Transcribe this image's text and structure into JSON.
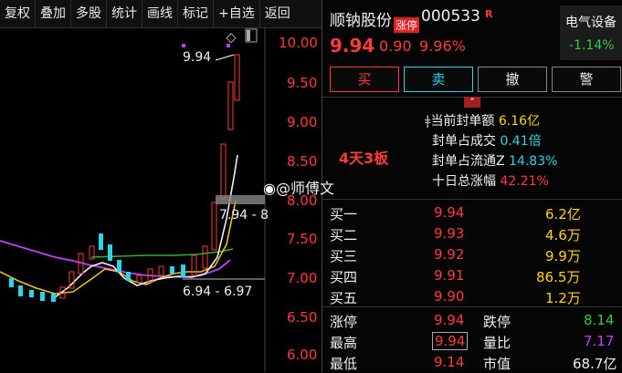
{
  "toolbar": [
    "复权",
    "叠加",
    "多股",
    "统计",
    "画线",
    "标记",
    "+自选",
    "返回"
  ],
  "axis": [
    "10.00",
    "9.50",
    "9.00",
    "8.50",
    "8.00",
    "7.50",
    "7.00",
    "6.50",
    "6.00"
  ],
  "chart_labels": {
    "high_marker": "9.94",
    "range_top": "7.94 - 8",
    "range_bottom": "6.94 - 6.97"
  },
  "watermark": "@师傅文",
  "stock": {
    "name": "顺钠股份",
    "limit_badge": "涨停",
    "code": "000533",
    "r_mark": "R",
    "price": "9.94",
    "change": "0.90",
    "pct": "9.96%"
  },
  "sector": {
    "name": "电气设备",
    "pct": "-1.14%"
  },
  "buttons": {
    "buy": "买",
    "sell": "卖",
    "cancel": "撤",
    "alert": "警"
  },
  "board_tag": "4天3板",
  "seal_info": [
    {
      "label": "当前封单额",
      "value": "6.16亿"
    },
    {
      "label": "封单占成交",
      "value": "0.41倍"
    },
    {
      "label": "封单占流通Z",
      "value": "14.83%"
    },
    {
      "label": "十日总涨幅",
      "value": "42.21%"
    }
  ],
  "bids": [
    {
      "label": "买一",
      "price": "9.94",
      "vol": "6.2亿"
    },
    {
      "label": "买二",
      "price": "9.93",
      "vol": "4.6万"
    },
    {
      "label": "买三",
      "price": "9.92",
      "vol": "9.9万"
    },
    {
      "label": "买四",
      "price": "9.91",
      "vol": "86.5万"
    },
    {
      "label": "买五",
      "price": "9.90",
      "vol": "1.2万"
    }
  ],
  "stats": {
    "limit_up_label": "涨停",
    "limit_up": "9.94",
    "limit_down_label": "跌停",
    "limit_down": "8.14",
    "high_label": "最高",
    "high": "9.94",
    "ratio_label": "量比",
    "ratio": "7.17",
    "low_label": "最低",
    "low": "9.14",
    "mcap_label": "市值",
    "mcap": "68.7亿"
  }
}
